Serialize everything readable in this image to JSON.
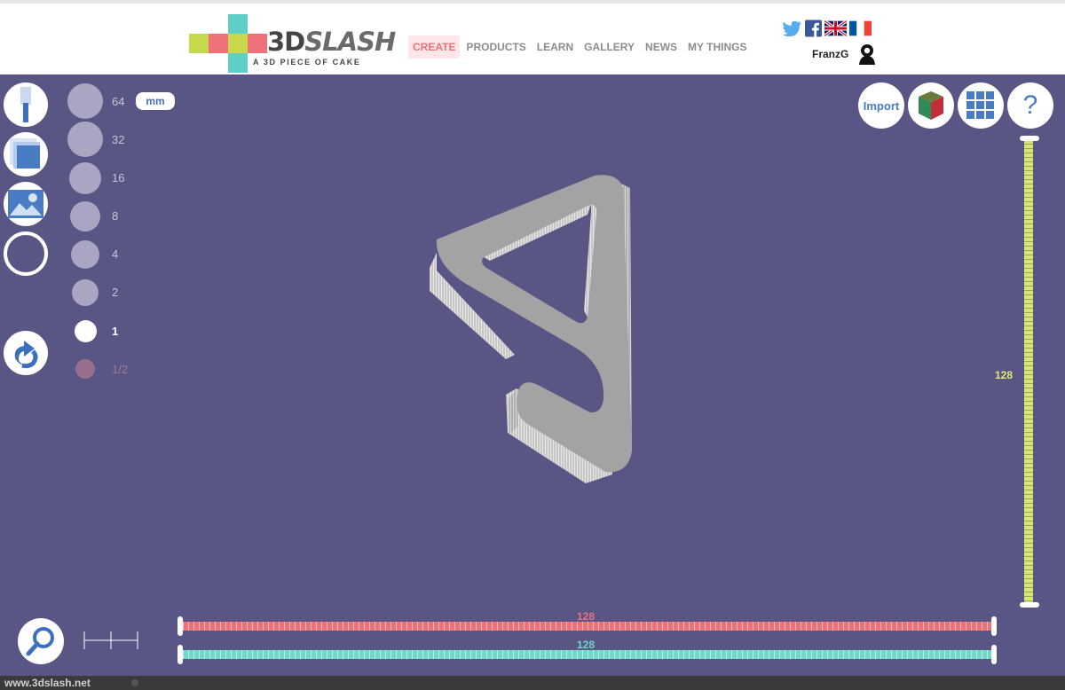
{
  "brand": {
    "name_prefix": "3D",
    "name_suffix": "SLASH",
    "tagline": "A 3D PIECE OF CAKE",
    "colors": {
      "green": "#c7d94a",
      "pink": "#f0707a",
      "teal": "#5fcfc5"
    }
  },
  "nav": {
    "items": [
      {
        "label": "CREATE",
        "active": true
      },
      {
        "label": "PRODUCTS",
        "active": false
      },
      {
        "label": "LEARN",
        "active": false
      },
      {
        "label": "GALLERY",
        "active": false
      },
      {
        "label": "NEWS",
        "active": false
      },
      {
        "label": "MY THINGS",
        "active": false
      }
    ]
  },
  "social": [
    "twitter-icon",
    "facebook-icon",
    "uk-flag-icon",
    "france-flag-icon"
  ],
  "user": {
    "name": "FranzG"
  },
  "tools": [
    "hammer-tool",
    "box-tool",
    "image-tool",
    "color-ring-tool",
    "undo-tool"
  ],
  "sizes": {
    "labels": [
      "64",
      "32",
      "16",
      "8",
      "4",
      "2",
      "1",
      "1/2"
    ],
    "selected": "1",
    "unit": "mm"
  },
  "top_right": {
    "import_label": "Import",
    "help_label": "?"
  },
  "sliders": {
    "vertical_value": "128",
    "horizontal_red_value": "128",
    "horizontal_teal_value": "128",
    "colors": {
      "yellow": "#d4e57a",
      "red": "#f0707a",
      "teal": "#6fd6c8"
    }
  },
  "status": {
    "url": "www.3dslash.net"
  }
}
